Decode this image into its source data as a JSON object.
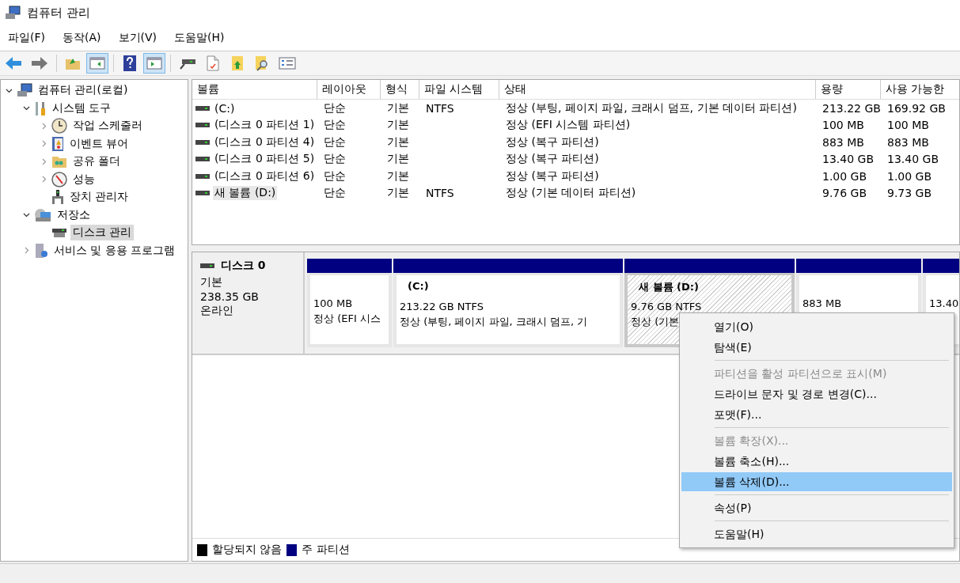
{
  "window": {
    "title": "컴퓨터 관리"
  },
  "menu_bar": [
    "파일(F)",
    "동작(A)",
    "보기(V)",
    "도움말(H)"
  ],
  "toolbar": [
    [
      {
        "kind": "back",
        "pressed": false
      },
      {
        "kind": "forward",
        "pressed": false
      }
    ],
    [
      {
        "kind": "up",
        "pressed": false
      },
      {
        "kind": "tree",
        "pressed": true
      }
    ],
    [
      {
        "kind": "help",
        "pressed": false
      },
      {
        "kind": "pane",
        "pressed": true
      }
    ],
    [
      {
        "kind": "connect",
        "pressed": false
      },
      {
        "kind": "check",
        "pressed": false
      },
      {
        "kind": "export",
        "pressed": false
      },
      {
        "kind": "find",
        "pressed": false
      },
      {
        "kind": "props",
        "pressed": false
      }
    ]
  ],
  "tree": [
    {
      "label": "컴퓨터 관리(로컬)",
      "kind": "computer",
      "selected": false,
      "expanded": true,
      "children": [
        {
          "label": "시스템 도구",
          "kind": "tools",
          "selected": false,
          "expanded": true,
          "children": [
            {
              "label": "작업 스케줄러",
              "kind": "clock",
              "selected": false,
              "expanded": false
            },
            {
              "label": "이벤트 뷰어",
              "kind": "event",
              "selected": false,
              "expanded": false
            },
            {
              "label": "공유 폴더",
              "kind": "share",
              "selected": false,
              "expanded": false
            },
            {
              "label": "성능",
              "kind": "perf",
              "selected": false,
              "expanded": false
            },
            {
              "label": "장치 관리자",
              "kind": "device",
              "selected": false
            }
          ]
        },
        {
          "label": "저장소",
          "kind": "storage",
          "selected": false,
          "expanded": true,
          "children": [
            {
              "label": "디스크 관리",
              "kind": "disk",
              "selected": true
            }
          ]
        },
        {
          "label": "서비스 및 응용 프로그램",
          "kind": "services",
          "selected": false,
          "expanded": false
        }
      ]
    }
  ],
  "volume_table": {
    "columns": [
      "볼륨",
      "레이아웃",
      "형식",
      "파일 시스템",
      "상태",
      "용량",
      "사용 가능한"
    ],
    "rows": [
      {
        "cells": [
          "(C:)",
          "단순",
          "기본",
          "NTFS",
          "정상 (부팅, 페이지 파일, 크래시 덤프, 기본 데이터 파티션)",
          "213.22 GB",
          "169.92 GB"
        ],
        "selected": false
      },
      {
        "cells": [
          "(디스크 0 파티션 1)",
          "단순",
          "기본",
          "",
          "정상 (EFI 시스템 파티션)",
          "100 MB",
          "100 MB"
        ],
        "selected": false
      },
      {
        "cells": [
          "(디스크 0 파티션 4)",
          "단순",
          "기본",
          "",
          "정상 (복구 파티션)",
          "883 MB",
          "883 MB"
        ],
        "selected": false
      },
      {
        "cells": [
          "(디스크 0 파티션 5)",
          "단순",
          "기본",
          "",
          "정상 (복구 파티션)",
          "13.40 GB",
          "13.40 GB"
        ],
        "selected": false
      },
      {
        "cells": [
          "(디스크 0 파티션 6)",
          "단순",
          "기본",
          "",
          "정상 (복구 파티션)",
          "1.00 GB",
          "1.00 GB"
        ],
        "selected": false
      },
      {
        "cells": [
          "새 볼륨 (D:)",
          "단순",
          "기본",
          "NTFS",
          "정상 (기본 데이터 파티션)",
          "9.76 GB",
          "9.73 GB"
        ],
        "selected": true
      }
    ]
  },
  "disk": {
    "name": "디스크 0",
    "type": "기본",
    "size": "238.35 GB",
    "status": "온라인",
    "partitions": [
      {
        "size": "100 MB",
        "status": "정상 (EFI 시스",
        "selected": false
      },
      {
        "label": "(C:)",
        "size": "213.22 GB NTFS",
        "status": "정상 (부팅, 페이지 파일, 크래시 덤프, 기",
        "selected": false
      },
      {
        "label": "새 볼륨  (D:)",
        "size": "9.76 GB NTFS",
        "status": "정상 (기본",
        "selected": true
      },
      {
        "size": "883 MB",
        "selected": false
      },
      {
        "size": "13.40",
        "selected": false
      }
    ]
  },
  "legend": [
    {
      "label": "할당되지 않음",
      "color": "#000000"
    },
    {
      "label": "주 파티션",
      "color": "#000080"
    }
  ],
  "context_menu": [
    [
      {
        "label": "열기(O)",
        "disabled": false,
        "selected": false
      },
      {
        "label": "탐색(E)",
        "disabled": false,
        "selected": false
      }
    ],
    [
      {
        "label": "파티션을 활성 파티션으로 표시(M)",
        "disabled": true,
        "selected": false
      },
      {
        "label": "드라이브 문자 및 경로 변경(C)...",
        "disabled": false,
        "selected": false
      },
      {
        "label": "포맷(F)...",
        "disabled": false,
        "selected": false
      }
    ],
    [
      {
        "label": "볼륨 확장(X)...",
        "disabled": true,
        "selected": false
      },
      {
        "label": "볼륨 축소(H)...",
        "disabled": false,
        "selected": false
      },
      {
        "label": "볼륨 삭제(D)...",
        "disabled": false,
        "selected": true
      }
    ],
    [
      {
        "label": "속성(P)",
        "disabled": false,
        "selected": false
      }
    ],
    [
      {
        "label": "도움말(H)",
        "disabled": false,
        "selected": false
      }
    ]
  ]
}
